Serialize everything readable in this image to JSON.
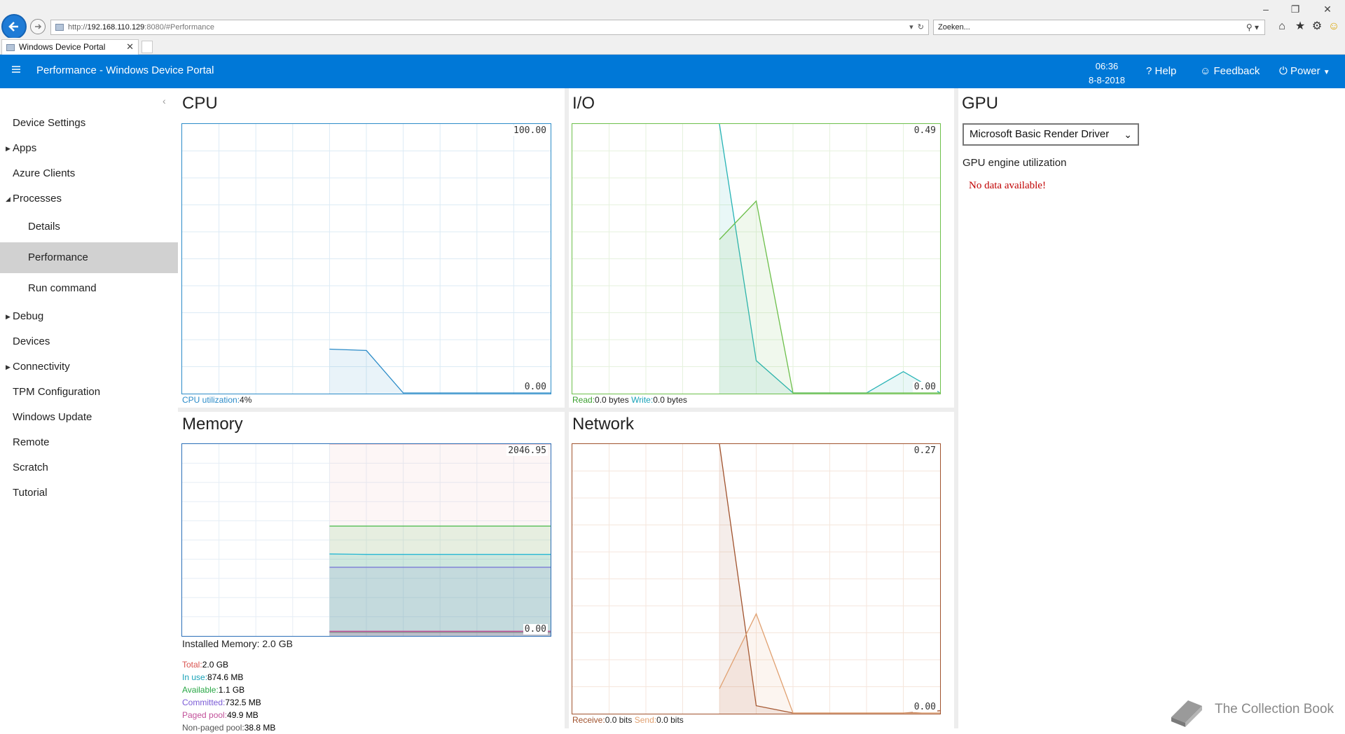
{
  "browser": {
    "url_prefix": "http://",
    "url_host": "192.168.110.129",
    "url_rest": ":8080/#Performance",
    "search_placeholder": "Zoeken...",
    "tab_title": "Windows Device Portal"
  },
  "header": {
    "title": "Performance - Windows Device Portal",
    "time": "06:36",
    "date": "8-8-2018",
    "help_label": "Help",
    "feedback_label": "Feedback",
    "power_label": "Power"
  },
  "sidebar": {
    "items": [
      {
        "label": "Device Settings"
      },
      {
        "label": "Apps"
      },
      {
        "label": "Azure Clients"
      },
      {
        "label": "Processes"
      },
      {
        "label": "Details"
      },
      {
        "label": "Performance"
      },
      {
        "label": "Run command"
      },
      {
        "label": "Debug"
      },
      {
        "label": "Devices"
      },
      {
        "label": "Connectivity"
      },
      {
        "label": "TPM Configuration"
      },
      {
        "label": "Windows Update"
      },
      {
        "label": "Remote"
      },
      {
        "label": "Scratch"
      },
      {
        "label": "Tutorial"
      }
    ]
  },
  "cpu": {
    "title": "CPU",
    "max_label": "100.00",
    "min_label": "0.00",
    "util_label": "CPU utilization:",
    "util_value": "4%"
  },
  "io": {
    "title": "I/O",
    "max_label": "0.49",
    "min_label": "0.00",
    "read_label": "Read:",
    "read_value": "0.0 bytes",
    "write_label": "Write:",
    "write_value": "0.0 bytes"
  },
  "memory": {
    "title": "Memory",
    "max_label": "2046.95",
    "min_label": "0.00",
    "installed": "Installed Memory: 2.0 GB",
    "stats": [
      {
        "label": "Total:",
        "value": "2.0 GB",
        "color": "#d9534f"
      },
      {
        "label": "In use:",
        "value": "874.6 MB",
        "color": "#17a2b8"
      },
      {
        "label": "Available:",
        "value": "1.1 GB",
        "color": "#28a745"
      },
      {
        "label": "Committed:",
        "value": "732.5 MB",
        "color": "#7b5bd6"
      },
      {
        "label": "Paged pool:",
        "value": "49.9 MB",
        "color": "#c2509a"
      },
      {
        "label": "Non-paged pool:",
        "value": "38.8 MB",
        "color": "#555555"
      }
    ]
  },
  "network": {
    "title": "Network",
    "max_label": "0.27",
    "min_label": "0.00",
    "receive_label": "Receive:",
    "receive_value": "0.0 bits",
    "send_label": "Send:",
    "send_value": "0.0 bits"
  },
  "gpu": {
    "title": "GPU",
    "driver": "Microsoft Basic Render Driver",
    "util_label": "GPU engine utilization",
    "no_data": "No data available!"
  },
  "watermark": "The Collection Book",
  "chart_data": [
    {
      "type": "area",
      "name": "cpu",
      "ylim": [
        0,
        100
      ],
      "x": [
        0,
        1,
        2,
        3,
        4,
        5,
        6,
        7,
        8,
        9,
        10
      ],
      "series": [
        {
          "values": [
            null,
            null,
            null,
            null,
            16.5,
            16,
            0,
            0,
            0,
            0,
            0
          ]
        }
      ],
      "color": "#2b8bc8"
    },
    {
      "type": "area",
      "name": "io",
      "ylim": [
        0,
        0.49
      ],
      "x": [
        0,
        1,
        2,
        3,
        4,
        5,
        6,
        7,
        8,
        9,
        10
      ],
      "series": [
        {
          "values": [
            null,
            null,
            null,
            null,
            0.49,
            0.06,
            0,
            0,
            0,
            0.04,
            0
          ]
        },
        {
          "values": [
            null,
            null,
            null,
            null,
            0.28,
            0.35,
            0,
            0,
            0,
            0,
            0
          ]
        }
      ],
      "colors": [
        "#26b3b5",
        "#6cbf4a"
      ]
    },
    {
      "type": "area",
      "name": "memory",
      "ylim": [
        0,
        2046.95
      ],
      "x": [
        0,
        1,
        2,
        3,
        4,
        5,
        6,
        7,
        8,
        9,
        10
      ],
      "series": [
        {
          "values": [
            null,
            null,
            null,
            null,
            2046.95,
            2046.95,
            2046.95,
            2046.95,
            2046.95,
            2046.95,
            2046.95
          ]
        },
        {
          "values": [
            null,
            null,
            null,
            null,
            1172,
            1172,
            1172,
            1172,
            1172,
            1172,
            1172
          ]
        },
        {
          "values": [
            null,
            null,
            null,
            null,
            874.6,
            870,
            870,
            870,
            870,
            870,
            870
          ]
        },
        {
          "values": [
            null,
            null,
            null,
            null,
            732.5,
            732.5,
            732.5,
            732.5,
            732.5,
            732.5,
            732.5
          ]
        },
        {
          "values": [
            null,
            null,
            null,
            null,
            49.9,
            49.9,
            49.9,
            49.9,
            49.9,
            49.9,
            49.9
          ]
        },
        {
          "values": [
            null,
            null,
            null,
            null,
            38.8,
            38.8,
            38.8,
            38.8,
            38.8,
            38.8,
            38.8
          ]
        }
      ],
      "colors": [
        "#f2b8b8",
        "#45b845",
        "#25b7d3",
        "#7b7bd6",
        "#c2509a",
        "#888888"
      ]
    },
    {
      "type": "area",
      "name": "network",
      "ylim": [
        0,
        0.27
      ],
      "x": [
        0,
        1,
        2,
        3,
        4,
        5,
        6,
        7,
        8,
        9,
        10
      ],
      "series": [
        {
          "values": [
            null,
            null,
            null,
            null,
            0.27,
            0.008,
            0,
            0,
            0,
            0,
            0.003
          ]
        },
        {
          "values": [
            null,
            null,
            null,
            null,
            0.025,
            0.1,
            0,
            0,
            0,
            0,
            0
          ]
        }
      ],
      "colors": [
        "#a0522d",
        "#e0a070"
      ]
    }
  ]
}
